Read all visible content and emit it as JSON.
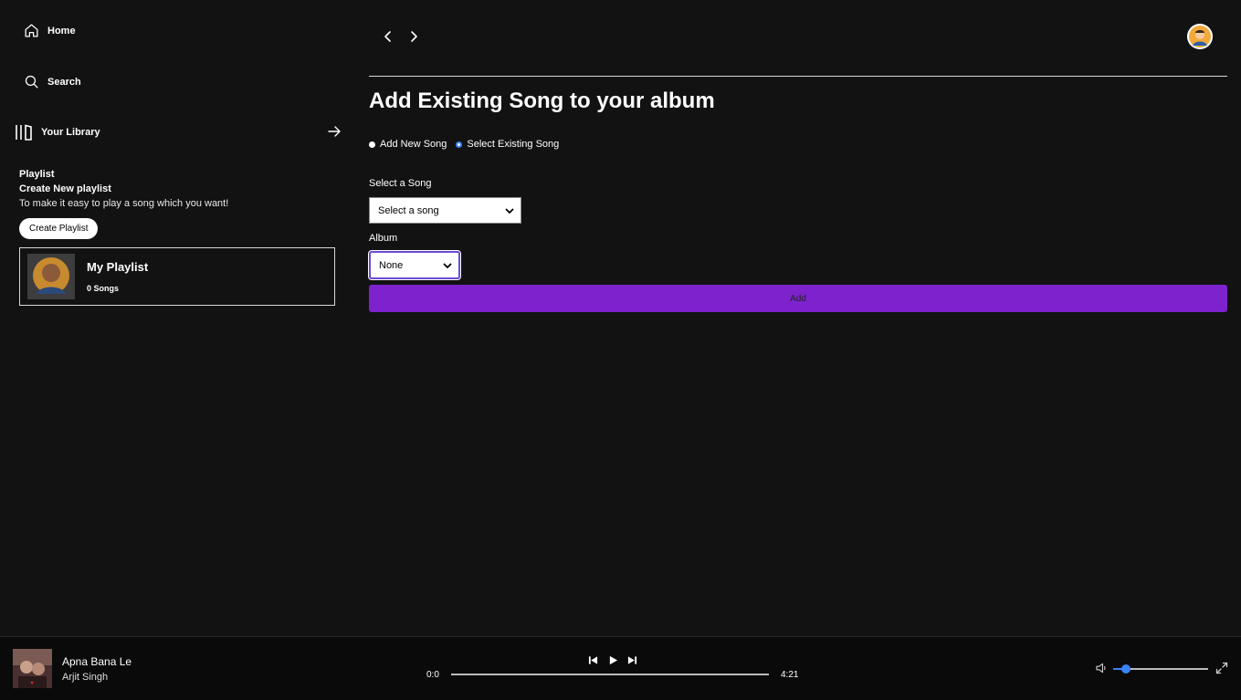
{
  "sidebar": {
    "home_label": "Home",
    "search_label": "Search",
    "library_label": "Your Library",
    "playlist": {
      "heading": "Playlist",
      "subheading": "Create New playlist",
      "description": "To make it easy to play a song which you want!",
      "create_button": "Create Playlist"
    },
    "playlists": [
      {
        "name": "My Playlist",
        "count": "0 Songs"
      }
    ]
  },
  "main": {
    "title": "Add Existing Song to your album",
    "radio_options": [
      {
        "label": "Add New Song",
        "selected": false
      },
      {
        "label": "Select Existing Song",
        "selected": true
      }
    ],
    "song_field": {
      "label": "Select a Song",
      "value": "Select a song"
    },
    "album_field": {
      "label": "Album",
      "value": "None"
    },
    "submit_label": "Add"
  },
  "player": {
    "track_title": "Apna Bana Le",
    "artist": "Arjit Singh",
    "current_time": "0:0",
    "total_time": "4:21",
    "progress": 0,
    "volume": 0.13
  },
  "colors": {
    "background": "#121212",
    "accent": "#7e22ce",
    "player_bg": "#0a0a0a",
    "slider": "#3b82f6"
  }
}
